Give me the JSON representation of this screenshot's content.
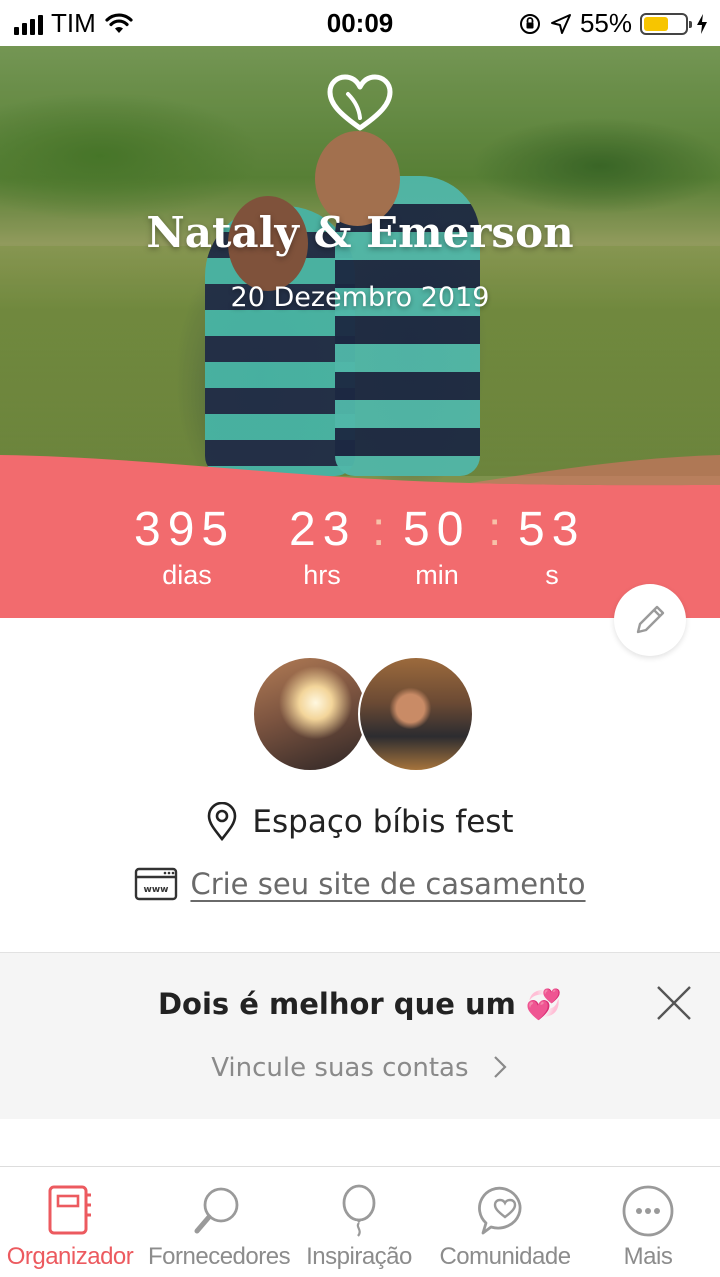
{
  "status_bar": {
    "carrier": "TIM",
    "time": "00:09",
    "battery": "55%"
  },
  "hero": {
    "title": "Nataly & Emerson",
    "date": "20 Dezembro 2019"
  },
  "countdown": {
    "days": "395",
    "hours": "23",
    "minutes": "50",
    "seconds": "53",
    "labels": {
      "days": "dias",
      "hours": "hrs",
      "minutes": "min",
      "seconds": "s"
    }
  },
  "venue": {
    "name": "Espaço bíbis fest"
  },
  "website": {
    "link": "Crie seu site de casamento"
  },
  "promo": {
    "title": "Dois é melhor que um 💞",
    "link": "Vincule suas contas"
  },
  "tabs": [
    {
      "label": "Organizador",
      "icon": "planner-icon",
      "active": true
    },
    {
      "label": "Fornecedores",
      "icon": "magnifier-icon",
      "active": false
    },
    {
      "label": "Inspiração",
      "icon": "balloon-icon",
      "active": false
    },
    {
      "label": "Comunidade",
      "icon": "chat-heart-icon",
      "active": false
    },
    {
      "label": "Mais",
      "icon": "more-icon",
      "active": false
    }
  ],
  "colors": {
    "accent": "#ec5a5f",
    "countdown_bg": "#f26b6e",
    "separator": "#f7c1a8"
  }
}
